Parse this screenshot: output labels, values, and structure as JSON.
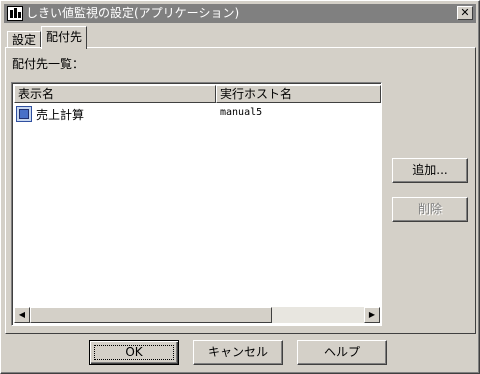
{
  "window": {
    "title": "しきい値監視の設定(アプリケーション)"
  },
  "tabs": [
    {
      "label": "設定",
      "active": false
    },
    {
      "label": "配付先",
      "active": true
    }
  ],
  "panel": {
    "list_label": "配付先一覧：",
    "columns": [
      "表示名",
      "実行ホスト名"
    ],
    "rows": [
      {
        "name": "売上計算",
        "host": "manual5",
        "icon": "application-icon"
      }
    ]
  },
  "side_buttons": {
    "add": "追加...",
    "delete": "削除"
  },
  "footer_buttons": {
    "ok": "OK",
    "cancel": "キャンセル",
    "help": "ヘルプ"
  },
  "colors": {
    "titlebar": "#808080",
    "face": "#d4d0c8",
    "list_bg": "#ffffff"
  }
}
